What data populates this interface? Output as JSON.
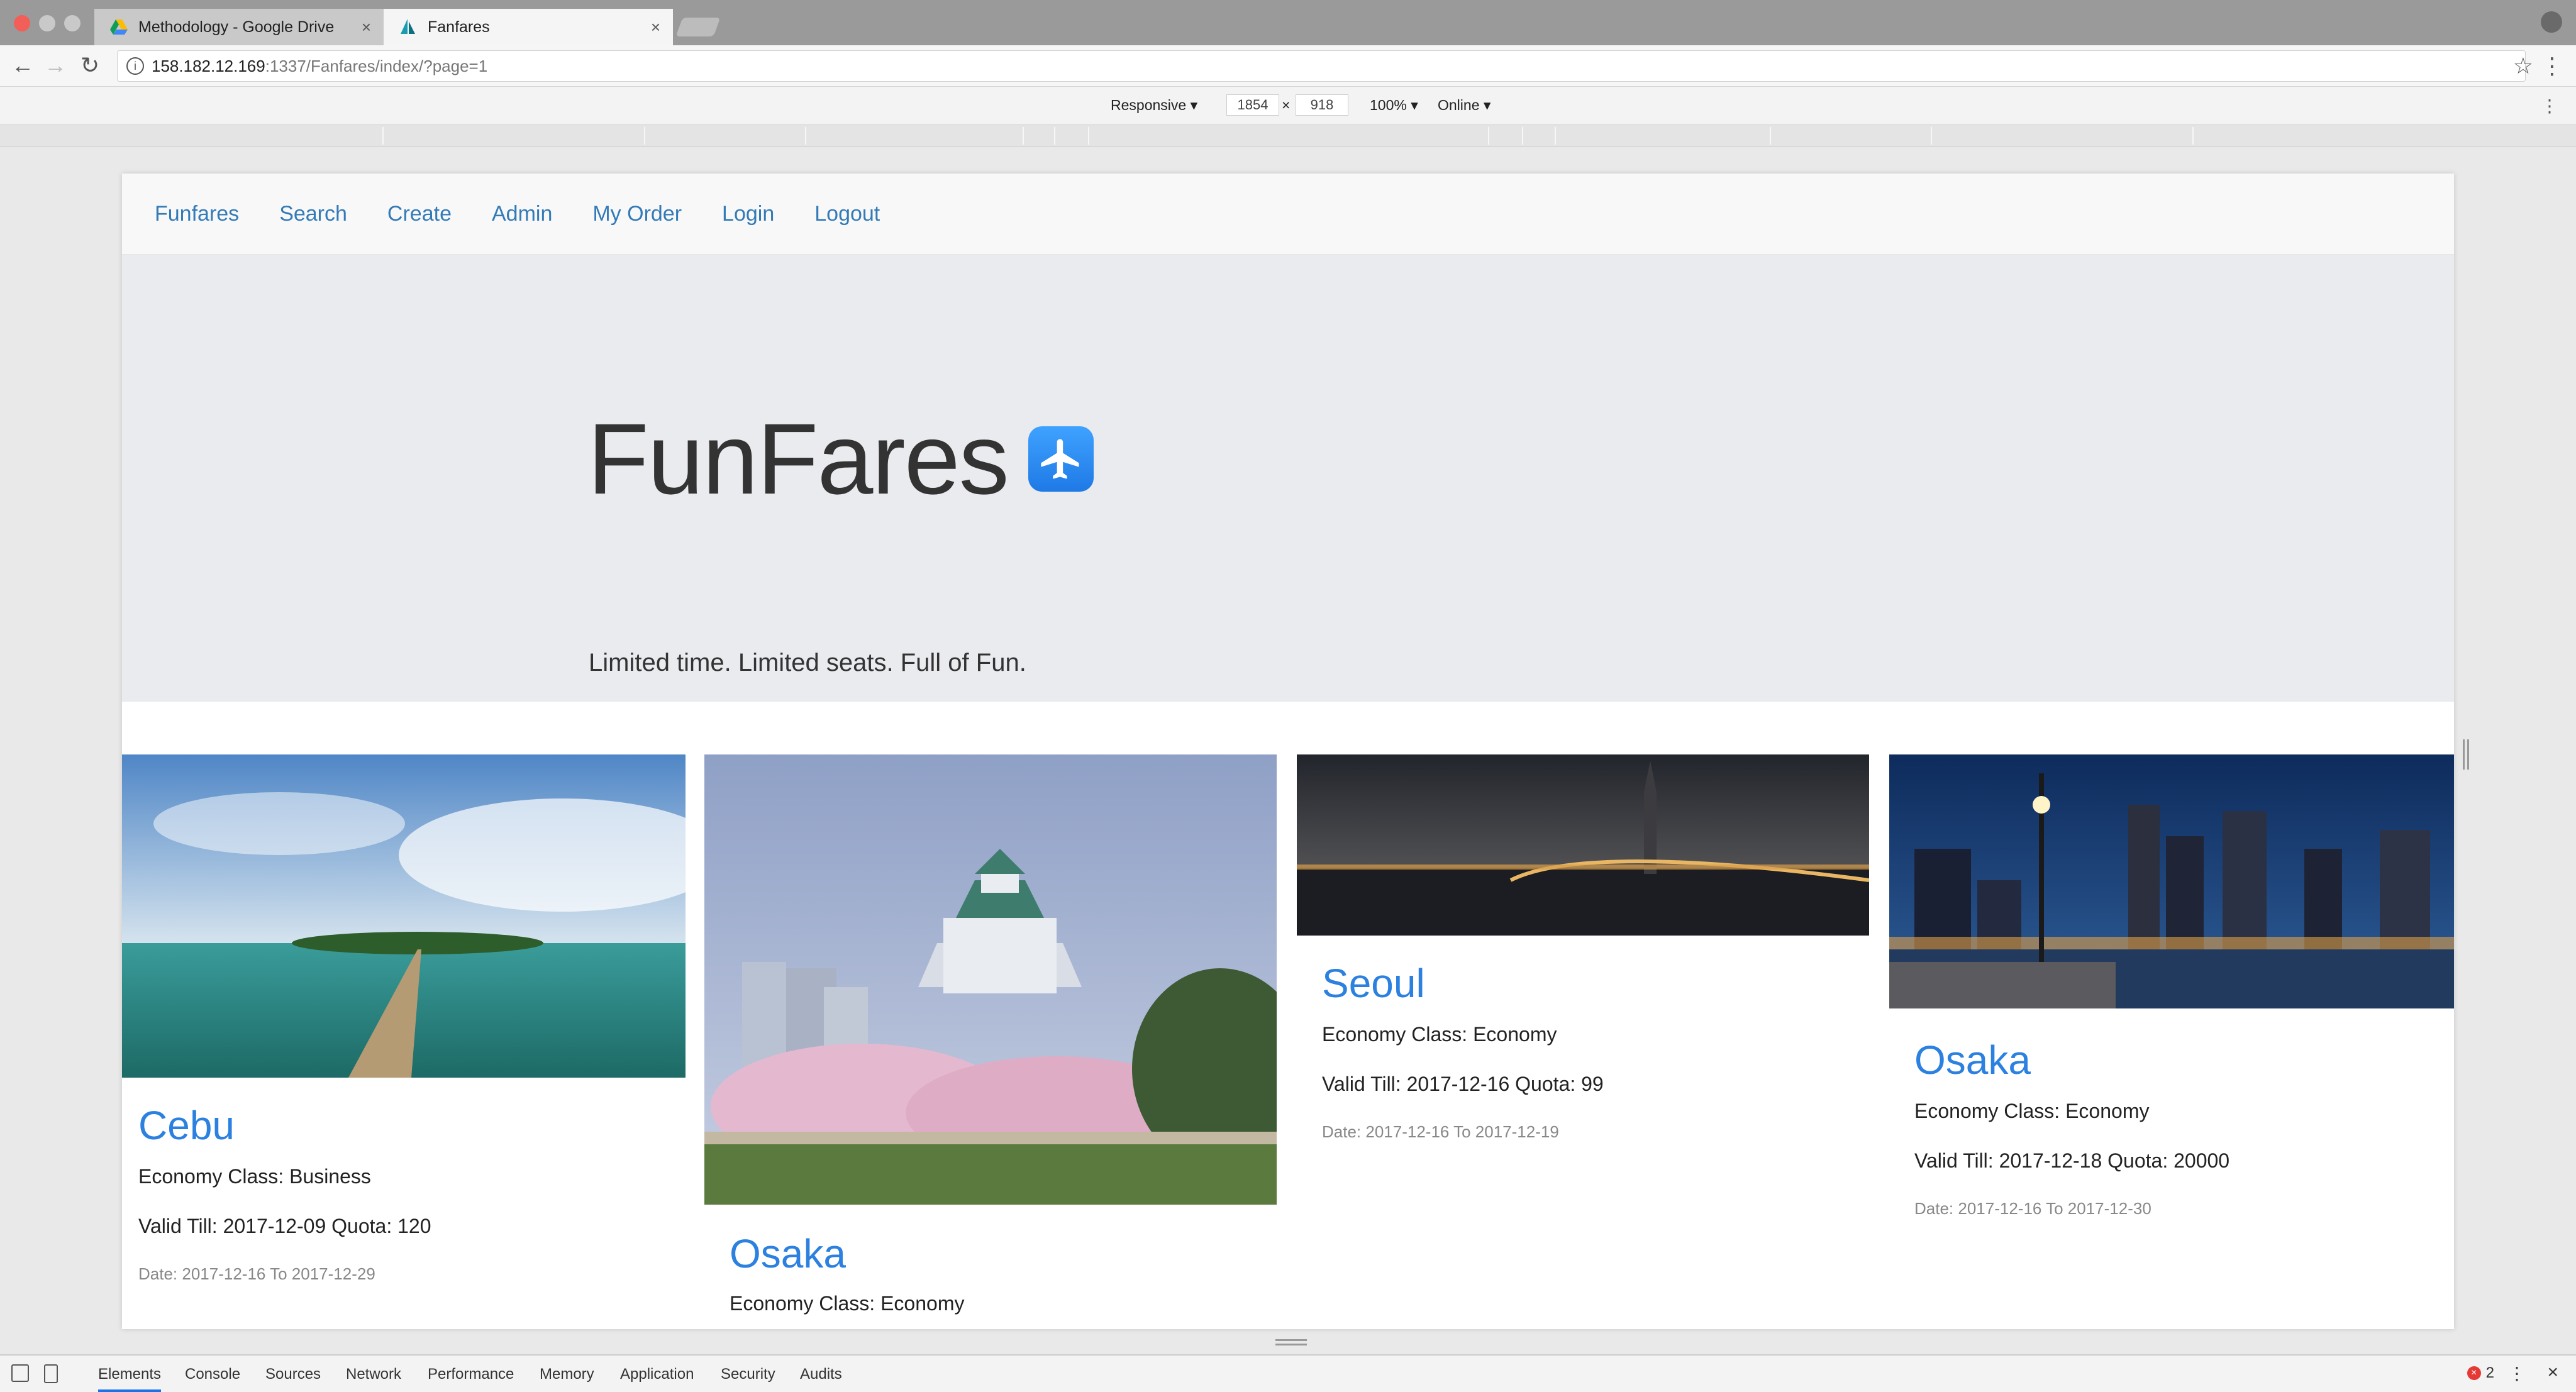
{
  "browser": {
    "tabs": [
      {
        "title": "Methodology - Google Drive",
        "close": "×"
      },
      {
        "title": "Fanfares",
        "close": "×"
      }
    ],
    "url_host": "158.182.12.169",
    "url_path": ":1337/Fanfares/index/?page=1"
  },
  "device_toolbar": {
    "mode": "Responsive ▾",
    "width": "1854",
    "times": "×",
    "height": "918",
    "zoom": "100% ▾",
    "network": "Online ▾"
  },
  "site": {
    "nav": [
      "Funfares",
      "Search",
      "Create",
      "Admin",
      "My Order",
      "Login",
      "Logout"
    ],
    "hero_title": "FunFares",
    "tagline": "Limited time. Limited seats. Full of Fun.",
    "cards": [
      {
        "city": "Cebu",
        "class_line": "Economy Class: Business",
        "valid_line": "Valid Till: 2017-12-09 Quota: 120",
        "date_line": "Date: 2017-12-16 To 2017-12-29"
      },
      {
        "city": "Osaka",
        "class_line": "Economy Class: Economy",
        "valid_line": "",
        "date_line": ""
      },
      {
        "city": "Seoul",
        "class_line": "Economy Class: Economy",
        "valid_line": "Valid Till: 2017-12-16 Quota: 99",
        "date_line": "Date: 2017-12-16 To 2017-12-19"
      },
      {
        "city": "Osaka",
        "class_line": "Economy Class: Economy",
        "valid_line": "Valid Till: 2017-12-18 Quota: 20000",
        "date_line": "Date: 2017-12-16 To 2017-12-30"
      }
    ]
  },
  "devtools": {
    "tabs": [
      "Elements",
      "Console",
      "Sources",
      "Network",
      "Performance",
      "Memory",
      "Application",
      "Security",
      "Audits"
    ],
    "error_count": "2"
  },
  "colors": {
    "link": "#337ab7",
    "card_title": "#2b80e0",
    "jumbotron_bg": "#eaebef"
  }
}
